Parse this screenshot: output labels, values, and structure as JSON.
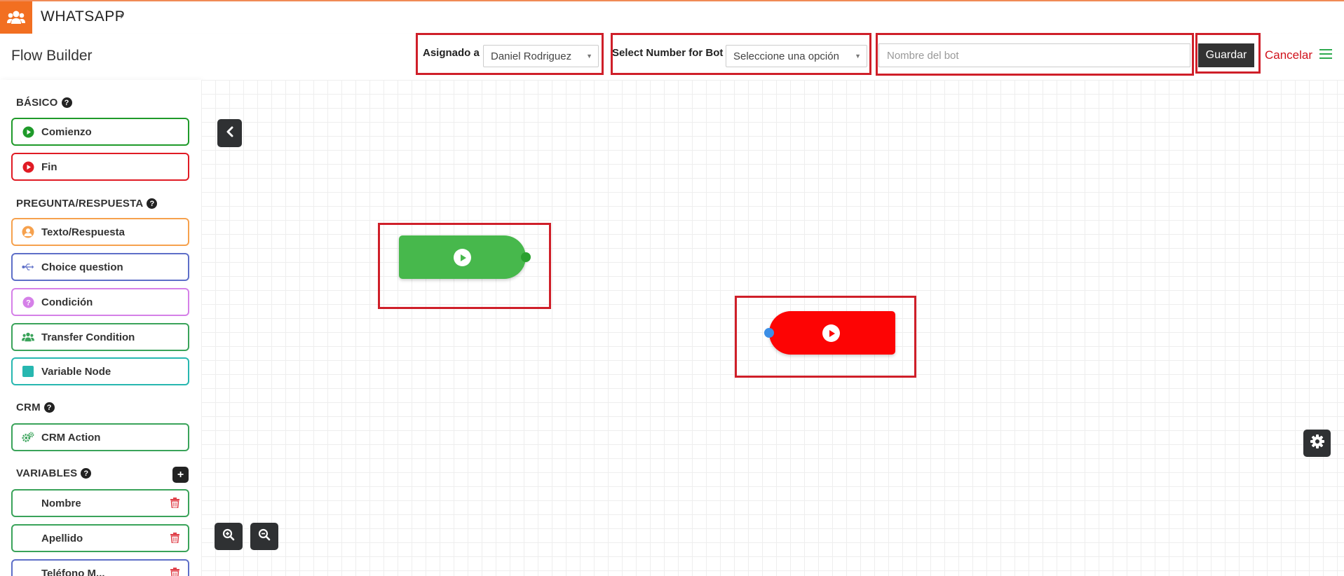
{
  "app": {
    "title": "WHATSAPP",
    "chevron": "›",
    "logo_icon": "users-icon",
    "accent_color": "#f26f21"
  },
  "header": {
    "page_title": "Flow Builder",
    "assigned_label": "Asignado a",
    "assigned_value": "Daniel Rodriguez",
    "number_label": "Select Number for Bot",
    "number_value": "Seleccione una opción",
    "bot_name_placeholder": "Nombre del bot",
    "bot_name_value": "",
    "save_label": "Guardar",
    "cancel_label": "Cancelar"
  },
  "sidebar": {
    "basic": {
      "title": "BÁSICO",
      "items": [
        {
          "label": "Comienzo",
          "icon": "play-circle-icon",
          "color": "#1f9a2a"
        },
        {
          "label": "Fin",
          "icon": "play-circle-icon",
          "color": "#e01b24"
        }
      ]
    },
    "qa": {
      "title": "PREGUNTA/RESPUESTA",
      "items": [
        {
          "label": "Texto/Respuesta",
          "icon": "user-icon",
          "color": "#f6a14d"
        },
        {
          "label": "Choice question",
          "icon": "usb-icon",
          "color": "#5e6fc8"
        },
        {
          "label": "Condición",
          "icon": "question-circle-icon",
          "color": "#d580e8"
        },
        {
          "label": "Transfer Condition",
          "icon": "users-icon",
          "color": "#3aa35a"
        },
        {
          "label": "Variable Node",
          "icon": "square-icon",
          "color": "#27b7b0"
        }
      ]
    },
    "crm": {
      "title": "CRM",
      "items": [
        {
          "label": "CRM Action",
          "icon": "gears-icon",
          "color": "#3aa35a"
        }
      ]
    },
    "variables": {
      "title": "VARIABLES",
      "add_label": "+",
      "items": [
        {
          "label": "Nombre",
          "color": "#3aa35a"
        },
        {
          "label": "Apellido",
          "color": "#3aa35a"
        },
        {
          "label": "Teléfono M...",
          "color": "#5e6fc8"
        }
      ]
    }
  },
  "canvas": {
    "start_node_color": "#47b84c",
    "end_node_color": "#fd0404",
    "buttons": [
      "collapse-sidebar-button",
      "zoom-in-button",
      "zoom-out-button",
      "settings-button"
    ]
  }
}
